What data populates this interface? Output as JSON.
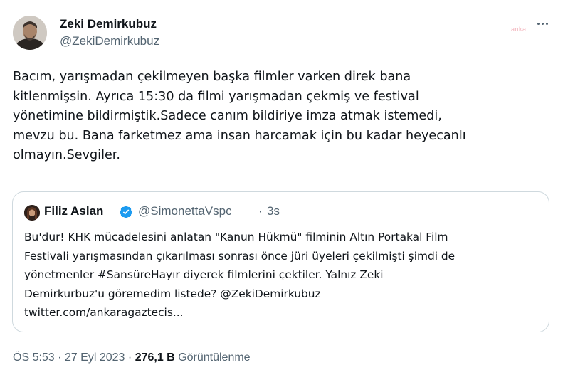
{
  "tweet": {
    "author": {
      "name": "Zeki Demirkubuz",
      "handle": "@ZekiDemirkubuz",
      "avatar_icon": "profile-photo"
    },
    "watermark": "anka",
    "more_icon": "more-horizontal-icon",
    "text": "Bacım, yarışmadan çekilmeyen başka filmler varken direk bana\nkitlenmişsin. Ayrıca 15:30 da filmi yarışmadan çekmiş ve festival\nyönetimine bildirmiştik.Sadece canım bildiriye imza atmak istemedi,\nmevzu bu. Bana farketmez ama insan harcamak için bu kadar heyecanlı\nolmayın.Sevgiler.",
    "quoted": {
      "name": "Filiz Aslan",
      "verified": true,
      "verified_color": "#1d9bf0",
      "handle": "@SimonettaVspc",
      "separator": "·",
      "time": "3s",
      "text": "Bu'dur! KHK mücadelesini anlatan \"Kanun Hükmü\" filminin Altın Portakal Film\nFestivali yarışmasından çıkarılması sonrası önce jüri üyeleri çekilmişti şimdi de\nyönetmenler #SansüreHayır diyerek filmlerini çektiler. Yalnız Zeki\nDemirkurbuz'u göremedim listede? @ZekiDemirkubuz\ntwitter.com/ankaragaztecis..."
    },
    "meta": {
      "time": "ÖS 5:53",
      "date": "27 Eyl 2023",
      "separator": "·",
      "views_count": "276,1 B",
      "views_label": "Görüntülenme"
    }
  }
}
